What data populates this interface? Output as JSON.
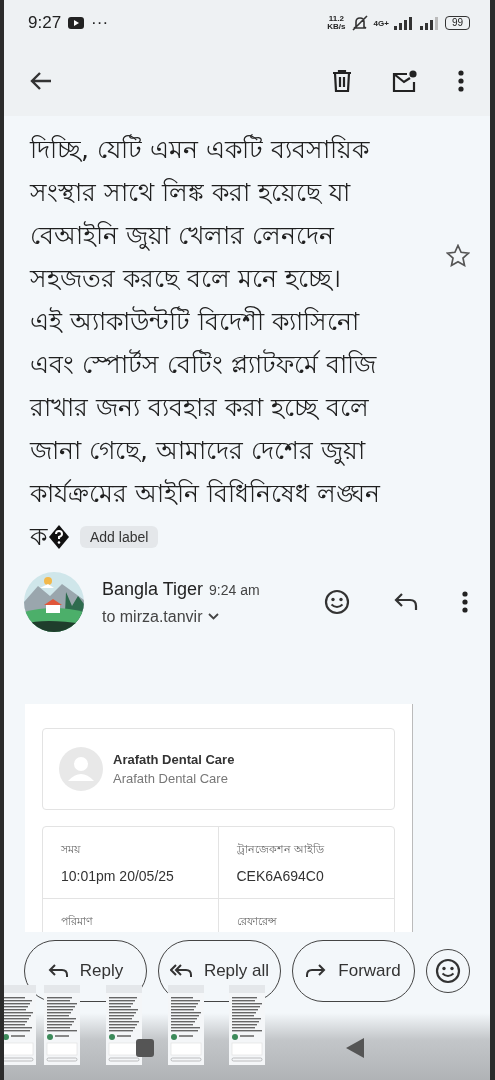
{
  "status_bar": {
    "time": "9:27",
    "overflow": "···",
    "speed": "11.2",
    "speed_unit": "KB/s",
    "network": "4G+",
    "battery": "99"
  },
  "message": {
    "lines": [
      "দিচ্ছি, যেটি এমন একটি ব্যবসায়িক",
      "সংস্থার সাথে লিঙ্ক করা হয়েছে যা",
      "বেআইনি জুয়া খেলার লেনদেন",
      "সহজতর করছে বলে মনে হচ্ছে।",
      "এই অ্যাকাউন্টটি বিদেশী ক্যাসিনো",
      "এবং স্পোর্টস বেটিং প্ল্যাটফর্মে বাজি",
      "রাখার জন্য ব্যবহার করা হচ্ছে বলে",
      "জানা গেছে, আমাদের দেশের জুয়া",
      "কার্যক্রমের আইনি বিধিনিষেধ লঙ্ঘন",
      "ক"
    ],
    "label_chip": "Add label",
    "starred": false
  },
  "sender": {
    "name": "Bangla Tiger",
    "time": "9:24 am",
    "recipient": "to mirza.tanvir"
  },
  "receipt": {
    "merchant": "Arafath Dental Care",
    "merchant_sub": "Arafath Dental Care",
    "fields": [
      {
        "label": "সময়",
        "value": "10:01pm 20/05/25"
      },
      {
        "label": "ট্রানজেকশন আইডি",
        "value": "CEK6A694C0"
      },
      {
        "label": "পরিমাণ"
      },
      {
        "label": "রেফারেন্স"
      }
    ]
  },
  "actions": [
    {
      "label": "Reply",
      "kind": "reply"
    },
    {
      "label": "Reply all",
      "kind": "reply_all"
    },
    {
      "label": "Forward",
      "kind": "forward"
    }
  ]
}
